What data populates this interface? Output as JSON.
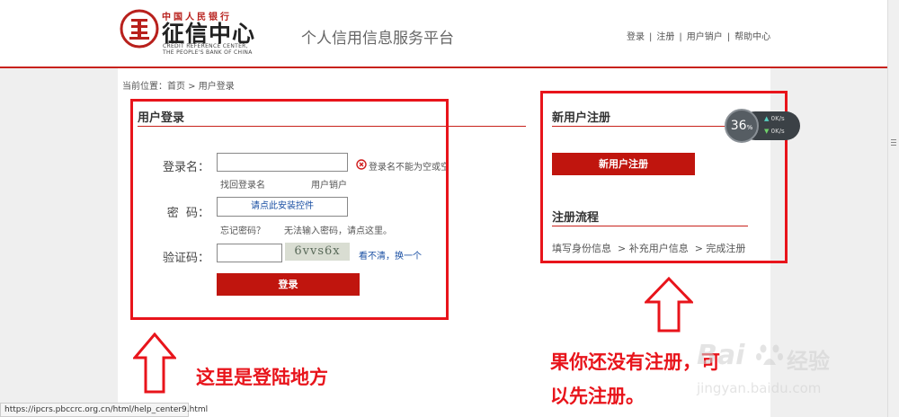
{
  "header": {
    "logo_top": "中国人民银行",
    "logo_main": "征信中心",
    "logo_en_line1": "CREDIT REFERENCE CENTER,",
    "logo_en_line2": "THE PEOPLE'S BANK OF CHINA",
    "platform_title": "个人信用信息服务平台",
    "nav": [
      "登录",
      "注册",
      "用户销户",
      "帮助中心"
    ],
    "nav_sep": "|"
  },
  "breadcrumb": "当前位置：首页 > 用户登录",
  "login": {
    "title": "用户登录",
    "username_label": "登录名：",
    "username_value": "",
    "username_error": "登录名不能为空或空格",
    "retrieve_link": "找回登录名",
    "cancel_link": "用户销户",
    "password_label": "密  码：",
    "install_control": "请点此安装控件",
    "forgot_password": "忘记密码？",
    "cannot_input": "无法输入密码，请点这里。",
    "captcha_label": "验证码：",
    "captcha_value": "",
    "captcha_text": "6vvs6x",
    "refresh_captcha": "看不清，换一个",
    "login_button": "登录"
  },
  "register": {
    "title": "新用户注册",
    "button": "新用户注册",
    "process_title": "注册流程",
    "steps": "填写身份信息  > 补充用户信息  > 完成注册"
  },
  "speed_widget": {
    "percent": "36",
    "percent_unit": "%",
    "up": "0",
    "down": "0",
    "unit": "K/s"
  },
  "annotations": {
    "left_text": "这里是登陆地方",
    "right_text_line1": "果你还没有注册，可",
    "right_text_line2": "以先注册。"
  },
  "watermark": {
    "brand": "Bai",
    "brand_cn": "经验",
    "url": "jingyan.baidu.com"
  },
  "status_url": "https://ipcrs.pbccrc.org.cn/html/help_center9.html",
  "colors": {
    "accent": "#c8221c",
    "annotation": "#e8141b",
    "link": "#1a4fa3"
  }
}
